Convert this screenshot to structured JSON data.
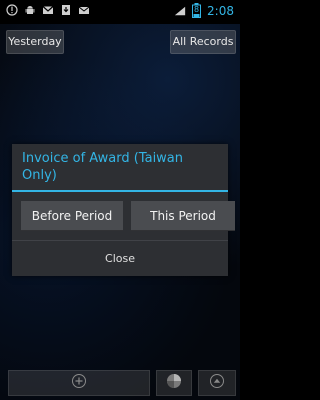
{
  "status_bar": {
    "time": "2:08",
    "battery": "8",
    "icons": [
      "exclamation-icon",
      "android-icon",
      "gmail-icon",
      "download-icon",
      "mail-icon",
      "signal-icon",
      "battery-icon"
    ]
  },
  "toolbar": {
    "yesterday_label": "Yesterday",
    "all_records_label": "All Records"
  },
  "dialog": {
    "title": "Invoice of Award (Taiwan Only)",
    "before_period_label": "Before Period",
    "this_period_label": "This Period",
    "close_label": "Close"
  },
  "bottom_bar": {
    "icons": [
      "add-icon",
      "sphere-icon",
      "up-icon"
    ]
  },
  "colors": {
    "accent": "#33b5e5",
    "dialog_bg": "#2d2f33",
    "button_bg": "#4a4c50"
  }
}
